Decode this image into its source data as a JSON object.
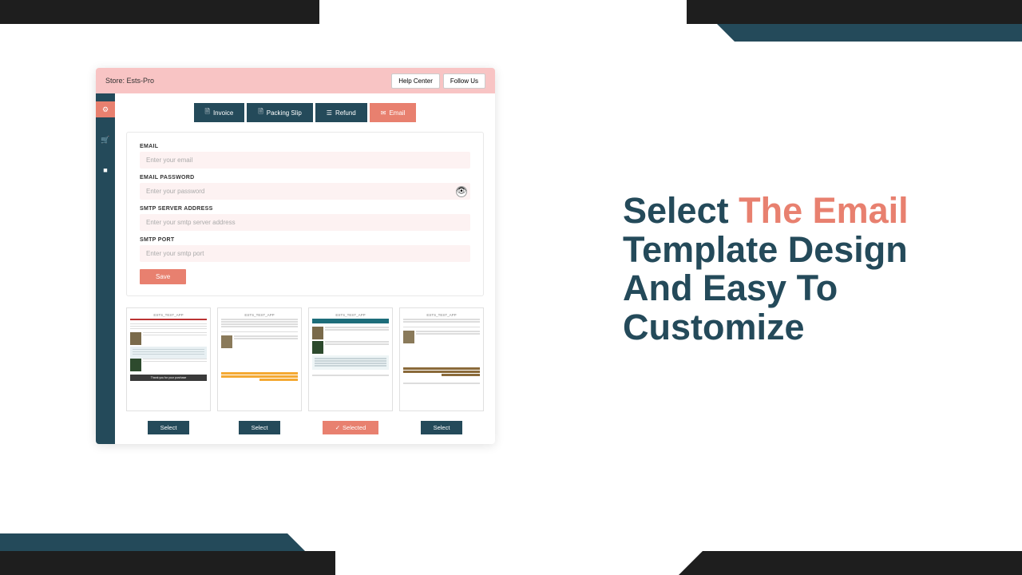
{
  "topbar": {
    "store_label": "Store: Ests-Pro",
    "help_center": "Help Center",
    "follow_us": "Follow Us"
  },
  "sidebar": {
    "items": [
      {
        "name": "settings",
        "glyph": "⚙",
        "active": true
      },
      {
        "name": "cart",
        "glyph": "🛒",
        "active": false
      },
      {
        "name": "user",
        "glyph": "👤",
        "active": false
      }
    ]
  },
  "tabs": {
    "invoice": "Invoice",
    "packing_slip": "Packing Slip",
    "refund": "Refund",
    "email": "Email"
  },
  "form": {
    "email_label": "EMAIL",
    "email_placeholder": "Enter your email",
    "password_label": "EMAIL PASSWORD",
    "password_placeholder": "Enter your password",
    "smtp_server_label": "SMTP SERVER ADDRESS",
    "smtp_server_placeholder": "Enter your smtp server address",
    "smtp_port_label": "SMTP PORT",
    "smtp_port_placeholder": "Enter your smtp port",
    "save": "Save"
  },
  "templates": {
    "header": "ESTS_TEST_APP",
    "select": "Select",
    "selected": "Selected",
    "thanks": "Thank you for your purchase"
  },
  "marketing": {
    "t1": "Select ",
    "t2": "The Email",
    "t3": " Template Design And Easy To Customize"
  }
}
